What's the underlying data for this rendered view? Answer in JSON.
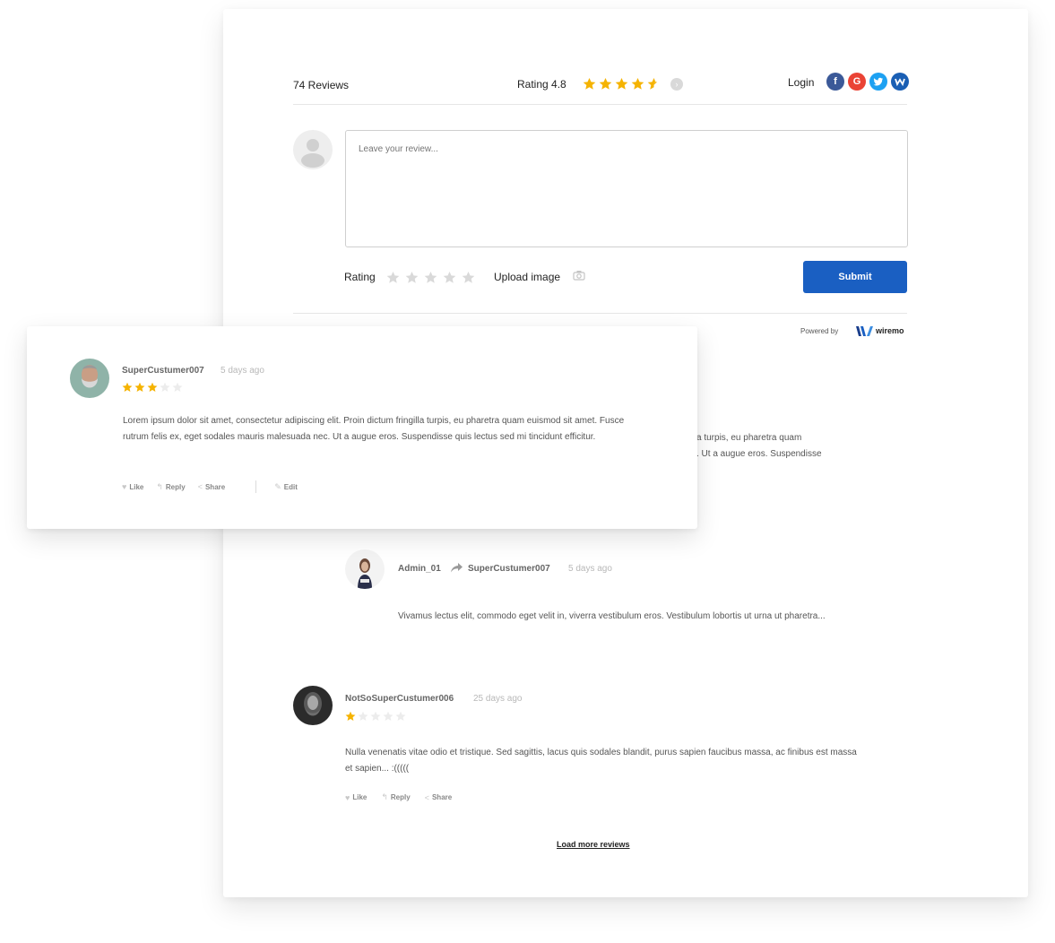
{
  "header": {
    "review_count": "74 Reviews",
    "rating_label": "Rating 4.8",
    "rating_value": 4.8,
    "login_label": "Login",
    "socials": [
      "facebook-icon",
      "google-icon",
      "twitter-icon",
      "wiremo-icon"
    ]
  },
  "form": {
    "placeholder": "Leave your review...",
    "rating_label": "Rating",
    "upload_label": "Upload image",
    "submit_label": "Submit"
  },
  "powered": {
    "label": "Powered by",
    "brand": "wiremo"
  },
  "reviews": [
    {
      "user": "SuperCustumer007",
      "time": "5 days ago",
      "stars": 3,
      "text": "Lorem ipsum dolor sit amet, consectetur adipiscing elit. Proin dictum fringilla turpis, eu pharetra quam euismod sit amet. Fusce rutrum felis ex, eget sodales mauris malesuada nec. Ut a augue eros. Suspendisse quis lectus sed mi tincidunt efficitur.",
      "actions": {
        "like": "Like",
        "reply": "Reply",
        "share": "Share",
        "edit": "Edit"
      }
    },
    {
      "user": "Admin_01",
      "reply_to": "SuperCustumer007",
      "time": "5 days ago",
      "text": "Vivamus lectus elit, commodo eget velit in, viverra vestibulum eros. Vestibulum lobortis ut urna ut pharetra..."
    },
    {
      "user": "NotSoSuperCustumer006",
      "time": "25 days ago",
      "stars": 1,
      "text": "Nulla venenatis vitae odio et tristique. Sed sagittis, lacus quis sodales blandit, purus sapien faucibus massa, ac finibus est massa et sapien... :(((((",
      "actions": {
        "like": "Like",
        "reply": "Reply",
        "share": "Share"
      }
    }
  ],
  "background_fragments": {
    "line1": "a turpis, eu pharetra quam",
    "line2": ". Ut a augue eros. Suspendisse"
  },
  "load_more": "Load more reviews",
  "colors": {
    "accent": "#1a5fc2",
    "star": "#f5b301",
    "star_empty": "#d9d9d9"
  }
}
